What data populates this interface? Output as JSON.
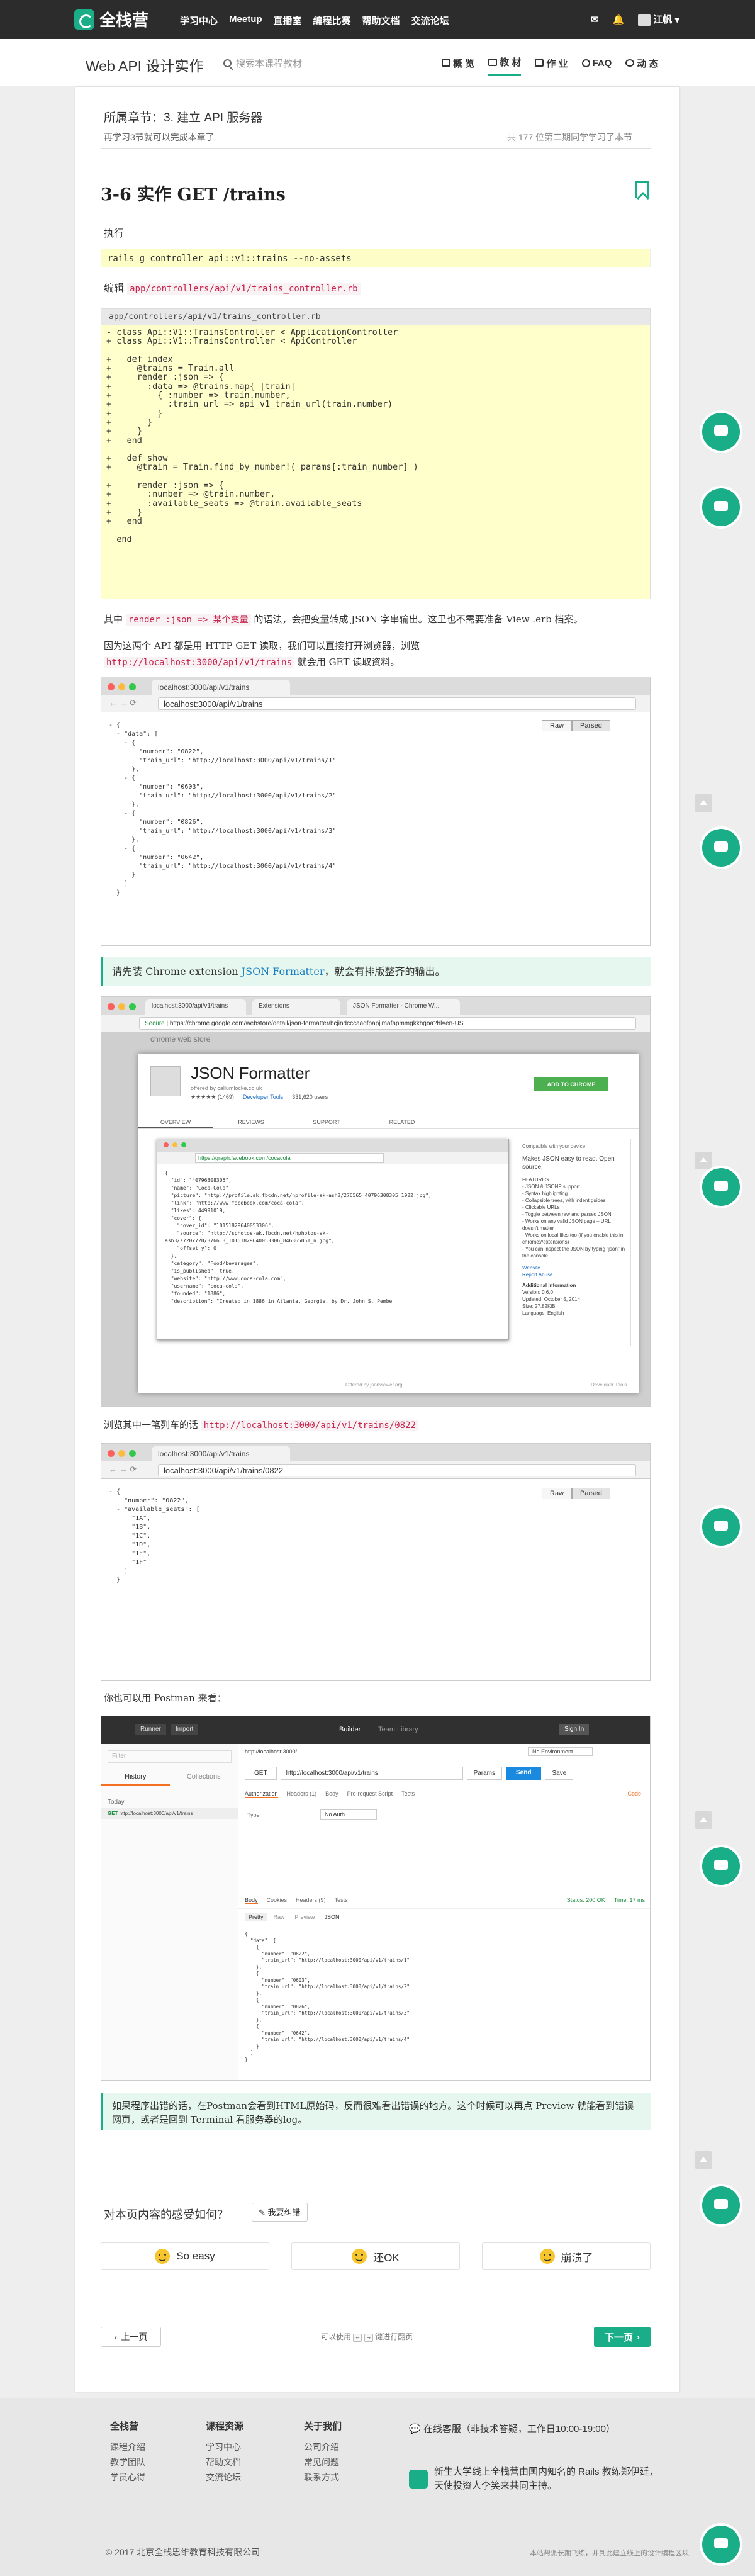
{
  "navbar": {
    "logo_text": "全栈营",
    "links": [
      "学习中心",
      "Meetup",
      "直播室",
      "编程比赛",
      "帮助文档",
      "交流论坛"
    ],
    "user_name": "江帆",
    "mail_icon": "mail-icon",
    "bell_icon": "bell-icon"
  },
  "subnav": {
    "course_title": "Web API 设计实作",
    "search_placeholder": "搜索本课程教材",
    "tabs": [
      {
        "label": "概 览",
        "icon": "monitor-icon"
      },
      {
        "label": "教 材",
        "icon": "book-icon"
      },
      {
        "label": "作 业",
        "icon": "folder-icon"
      },
      {
        "label": "FAQ",
        "icon": "question-icon"
      },
      {
        "label": "动 态",
        "icon": "eye-icon"
      }
    ],
    "active_tab": "教 材"
  },
  "chapter": {
    "title": "所属章节：3. 建立 API 服务器",
    "note": "再学习3节就可以完成本章了",
    "count": "共 177 位第二期同学学习了本节"
  },
  "section": {
    "title": "3-6 实作 GET /trains"
  },
  "content": {
    "p_exec": "执行",
    "cmd": "rails g controller api::v1::trains --no-assets",
    "p_edit_prefix": "编辑",
    "p_edit_code": "app/controllers/api/v1/trains_controller.rb",
    "codefile_name": "app/controllers/api/v1/trains_controller.rb",
    "codefile_lines": [
      "- class Api::V1::TrainsController < ApplicationController",
      "+ class Api::V1::TrainsController < ApiController",
      "",
      "+   def index",
      "+     @trains = Train.all",
      "+     render :json => {",
      "+       :data => @trains.map{ |train|",
      "+         { :number => train.number,",
      "+           :train_url => api_v1_train_url(train.number)",
      "+         }",
      "+       }",
      "+     }",
      "+   end",
      "",
      "+   def show",
      "+     @train = Train.find_by_number!( params[:train_number] )",
      "",
      "+     render :json => {",
      "+       :number => @train.number,",
      "+       :available_seats => @train.available_seats",
      "+     }",
      "+   end",
      "",
      "  end"
    ],
    "p_render_1": "其中",
    "p_render_code": "render :json => 某个变量",
    "p_render_2": "的语法，会把变量转成 JSON 字串输出。这里也不需要准备 View .erb 档案。",
    "p_browser_1": "因为这两个 API 都是用 HTTP GET 读取，我们可以直接打开浏览器，浏览",
    "p_browser_code": "http://localhost:3000/api/v1/trains",
    "p_browser_2": "就会用 GET 读取资料。",
    "callout_1_prefix": "请先装 Chrome extension",
    "callout_1_link": "JSON Formatter",
    "callout_1_suffix": "，就会有排版整齐的输出。",
    "p_single_1": "浏览其中一笔列车的话",
    "p_single_code": "http://localhost:3000/api/v1/trains/0822",
    "p_postman": "你也可以用 Postman 来看：",
    "callout_2": "如果程序出错的话，在Postman会看到HTML原始码，反而很难看出错误的地方。这个时候可以再点 Preview 就能看到错误网页，或者是回到 Terminal 看服务器的log。"
  },
  "shot1": {
    "tab_title": "localhost:3000/api/v1/trains",
    "url": "localhost:3000/api/v1/trains",
    "raw": "Raw",
    "parsed": "Parsed",
    "json_lines": [
      "- {",
      "  - \"data\": [",
      "    - {",
      "        \"number\": \"0822\",",
      "        \"train_url\": \"http://localhost:3000/api/v1/trains/1\"",
      "      },",
      "    - {",
      "        \"number\": \"0603\",",
      "        \"train_url\": \"http://localhost:3000/api/v1/trains/2\"",
      "      },",
      "    - {",
      "        \"number\": \"0826\",",
      "        \"train_url\": \"http://localhost:3000/api/v1/trains/3\"",
      "      },",
      "    - {",
      "        \"number\": \"0642\",",
      "        \"train_url\": \"http://localhost:3000/api/v1/trains/4\"",
      "      }",
      "    ]",
      "  }"
    ]
  },
  "shot2": {
    "tabs": [
      "localhost:3000/api/v1/trains",
      "Extensions",
      "JSON Formatter - Chrome W..."
    ],
    "url_secure": "Secure",
    "url": "https://chrome.google.com/webstore/detail/json-formatter/bcjindcccaagfpapjjmafapmmgkkhgoa?hl=en-US",
    "store_name": "chrome web store",
    "ext_name": "JSON Formatter",
    "offered_by": "offered by callumlocke.co.uk",
    "rating": "★★★★★ (1469)",
    "category": "Developer Tools",
    "users": "331,620 users",
    "add_button": "ADD TO CHROME",
    "nav_tabs": [
      "OVERVIEW",
      "REVIEWS",
      "SUPPORT",
      "RELATED"
    ],
    "inner_url": "https://graph.facebook.com/cocacola",
    "inner_json": [
      "{",
      "  \"id\": \"40796308305\",",
      "  \"name\": \"Coca-Cola\",",
      "  \"picture\": \"http://profile.ak.fbcdn.net/hprofile-ak-ash2/276565_40796308305_1922.jpg\",",
      "  \"link\": \"http://www.facebook.com/coca-cola\",",
      "  \"likes\": 44991019,",
      "  \"cover\": {",
      "    \"cover_id\": \"10151829640053306\",",
      "    \"source\": \"http://sphotos-ak.fbcdn.net/hphotos-ak-",
      "ash3/s720x720/376613_10151829640053306_846365051_n.jpg\",",
      "    \"offset_y\": 0",
      "  },",
      "  \"category\": \"Food/beverages\",",
      "  \"is_published\": true,",
      "  \"website\": \"http://www.coca-cola.com\",",
      "  \"username\": \"coca-cola\",",
      "  \"founded\": \"1886\",",
      "  \"description\": \"Created in 1886 in Atlanta, Georgia, by Dr. John S. Pembe"
    ],
    "side_compat": "Compatible with your device",
    "side_desc": "Makes JSON easy to read. Open source.",
    "side_features": [
      "FEATURES",
      "- JSON & JSONP support",
      "- Syntax highlighting",
      "- Collapsible trees, with indent guides",
      "- Clickable URLs",
      "- Toggle between raw and parsed JSON",
      "- Works on any valid JSON page – URL doesn't matter",
      "- Works on local files too (if you enable this in chrome://extensions)",
      "- You can inspect the JSON by typing \"json\" in the console"
    ],
    "side_website": "Website",
    "side_abuse": "Report Abuse",
    "side_info": "Additional Information",
    "side_version": "Version: 0.6.0",
    "side_updated": "Updated: October 5, 2014",
    "side_size": "Size: 27.82KiB",
    "side_lang": "Language: English",
    "footer_offered": "Offered by jsonviewer.org",
    "footer_dev": "Developer Tools"
  },
  "shot3": {
    "tab_title": "localhost:3000/api/v1/trains",
    "url": "localhost:3000/api/v1/trains/0822",
    "raw": "Raw",
    "parsed": "Parsed",
    "json_lines": [
      "- {",
      "    \"number\": \"0822\",",
      "  - \"available_seats\": [",
      "      \"1A\",",
      "      \"1B\",",
      "      \"1C\",",
      "      \"1D\",",
      "      \"1E\",",
      "      \"1F\"",
      "    ]",
      "  }"
    ]
  },
  "postman": {
    "runner": "Runner",
    "import": "Import",
    "builder_tab": "Builder",
    "team_tab": "Team Library",
    "signin": "Sign In",
    "filter_placeholder": "Filter",
    "history_tab": "History",
    "collections_tab": "Collections",
    "today": "Today",
    "history_item": "http://localhost:3000/api/v1/trains",
    "req_tab": "http://localhost:3000/",
    "env": "No Environment",
    "method": "GET",
    "url": "http://localhost:3000/api/v1/trains",
    "params": "Params",
    "send": "Send",
    "save": "Save",
    "req_tabs": [
      "Authorization",
      "Headers (1)",
      "Body",
      "Pre-request Script",
      "Tests"
    ],
    "code_link": "Code",
    "type_label": "Type",
    "type_value": "No Auth",
    "resp_tabs": [
      "Body",
      "Cookies",
      "Headers (9)",
      "Tests"
    ],
    "status": "Status: 200 OK",
    "time": "Time: 17 ms",
    "view_modes": [
      "Pretty",
      "Raw",
      "Preview"
    ],
    "format": "JSON",
    "resp_lines": [
      "{",
      "  \"data\": [",
      "    {",
      "      \"number\": \"0822\",",
      "      \"train_url\": \"http://localhost:3000/api/v1/trains/1\"",
      "    },",
      "    {",
      "      \"number\": \"0603\",",
      "      \"train_url\": \"http://localhost:3000/api/v1/trains/2\"",
      "    },",
      "    {",
      "      \"number\": \"0826\",",
      "      \"train_url\": \"http://localhost:3000/api/v1/trains/3\"",
      "    },",
      "    {",
      "      \"number\": \"0642\",",
      "      \"train_url\": \"http://localhost:3000/api/v1/trains/4\"",
      "    }",
      "  ]",
      "}"
    ]
  },
  "feedback": {
    "question": "对本页内容的感受如何？",
    "issue_button": "我要纠错",
    "reactions": [
      "So easy",
      "还OK",
      "崩溃了"
    ]
  },
  "pager": {
    "prev": "上一页",
    "next": "下一页",
    "hint_prefix": "可以使用",
    "hint_suffix": "键进行翻页",
    "key_left": "←",
    "key_right": "→"
  },
  "footer": {
    "cols": [
      {
        "title": "全栈营",
        "items": [
          "课程介绍",
          "教学团队",
          "学员心得"
        ]
      },
      {
        "title": "课程资源",
        "items": [
          "学习中心",
          "帮助文档",
          "交流论坛"
        ]
      },
      {
        "title": "关于我们",
        "items": [
          "公司介绍",
          "常见问题",
          "联系方式"
        ]
      }
    ],
    "hotline": "在线客服（非技术答疑，工作日10:00-19:00）",
    "slogan": "新生大学线上全栈营由国内知名的 Rails 教练郑伊廷，天使投资人李笑来共同主持。",
    "copyright": "© 2017 北京全栈思维教育科技有限公司",
    "link": "本站帮派长期飞练，并到此建立线上的设计编程区块"
  },
  "colors": {
    "brand": "#1aae88",
    "navbar": "#2c2c2c",
    "code_bg": "#ffffcc",
    "inline_code": "#c7254e",
    "callout_bg": "#e5f7ee"
  }
}
